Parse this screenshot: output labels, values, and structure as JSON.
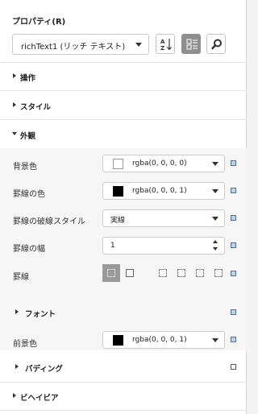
{
  "panel": {
    "title": "プロパティ(R)",
    "object_selector": {
      "value": "richText1 (リッチ テキスト)"
    },
    "toolbar": {
      "sort_icon_name": "sort-alphabetical-icon",
      "categorized_icon_name": "categorized-view-icon",
      "search_icon_name": "search-icon"
    }
  },
  "sections": {
    "operation": "操作",
    "style": "スタイル",
    "appearance": "外観",
    "font": "フォント",
    "padding": "パディング",
    "behavior": "ビヘイビア"
  },
  "properties": {
    "background_color": {
      "label": "背景色",
      "value": "rgba(0, 0, 0, 0)"
    },
    "border_color": {
      "label": "罫線の色",
      "value": "rgba(0, 0, 0, 1)"
    },
    "border_dash_style": {
      "label": "罫線の破線スタイル",
      "value": "実線"
    },
    "border_width": {
      "label": "罫線の幅",
      "value": "1"
    },
    "border": {
      "label": "罫線"
    },
    "foreground_color": {
      "label": "前景色",
      "value": "rgba(0, 0, 0, 1)"
    }
  },
  "colors": {
    "indicator_fill": "#b7d5ea",
    "active_button": "#8f8f8f",
    "expanded_background": "#f6f6f6"
  }
}
